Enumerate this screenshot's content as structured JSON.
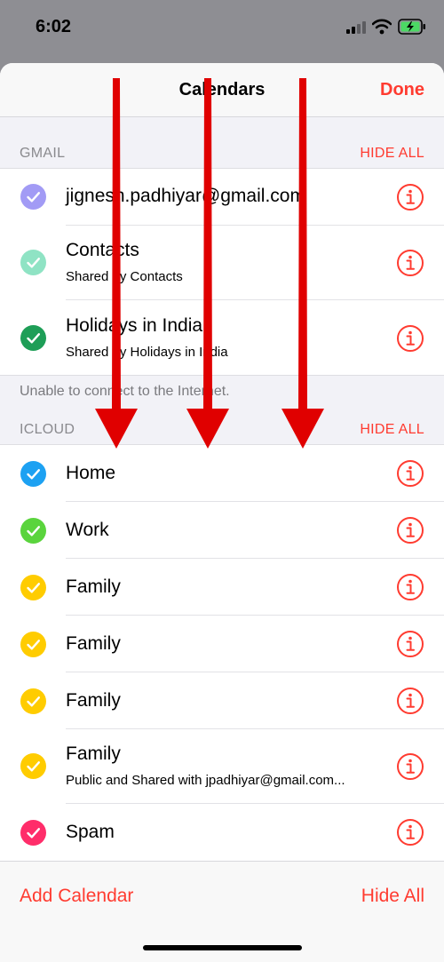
{
  "status": {
    "time": "6:02"
  },
  "nav": {
    "title": "Calendars",
    "done": "Done"
  },
  "sections": [
    {
      "title": "GMAIL",
      "hide_all": "HIDE ALL",
      "items": [
        {
          "title": "jignesh.padhiyar@gmail.com",
          "subtitle": "",
          "color": "#a29bf5"
        },
        {
          "title": "Contacts",
          "subtitle": "Shared by Contacts",
          "color": "#8fe3c4"
        },
        {
          "title": "Holidays in India",
          "subtitle": "Shared by Holidays in India",
          "color": "#1e9e57"
        }
      ]
    },
    {
      "title": "ICLOUD",
      "hide_all": "HIDE ALL",
      "items": [
        {
          "title": "Home",
          "subtitle": "",
          "color": "#1da1f2"
        },
        {
          "title": "Work",
          "subtitle": "",
          "color": "#5ad43d"
        },
        {
          "title": "Family",
          "subtitle": "",
          "color": "#ffcc00"
        },
        {
          "title": "Family",
          "subtitle": "",
          "color": "#ffcc00"
        },
        {
          "title": "Family",
          "subtitle": "",
          "color": "#ffcc00"
        },
        {
          "title": "Family",
          "subtitle": "Public and Shared with jpadhiyar@gmail.com...",
          "color": "#ffcc00"
        },
        {
          "title": "Spam",
          "subtitle": "",
          "color": "#ff2d6a"
        }
      ]
    }
  ],
  "offline_note": "Unable to connect to the Internet.",
  "toolbar": {
    "add_calendar": "Add Calendar",
    "hide_all": "Hide All"
  },
  "colors": {
    "accent": "#ff3b30",
    "annotation_arrow": "#e00000"
  }
}
